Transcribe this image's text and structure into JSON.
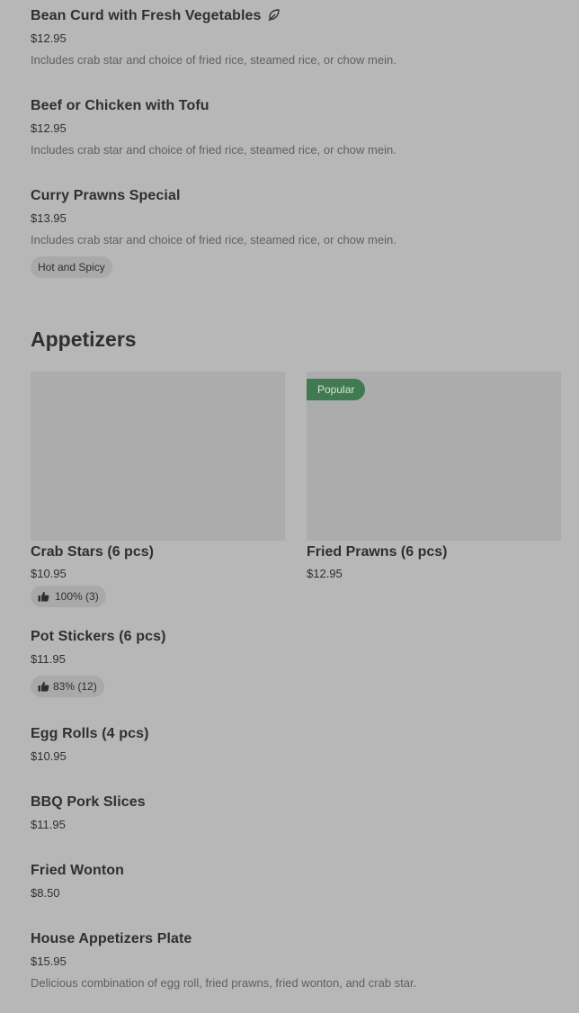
{
  "top_items": [
    {
      "name": "Bean Curd with Fresh Vegetables",
      "price": "$12.95",
      "description": "Includes crab star and choice of fried rice, steamed rice, or chow mein.",
      "icon": "leaf-icon"
    },
    {
      "name": "Beef or Chicken with Tofu",
      "price": "$12.95",
      "description": "Includes crab star and choice of fried rice, steamed rice, or chow mein."
    },
    {
      "name": "Curry Prawns Special",
      "price": "$13.95",
      "description": "Includes crab star and choice of fried rice, steamed rice, or chow mein.",
      "tag": "Hot and Spicy"
    }
  ],
  "section": {
    "title": "Appetizers"
  },
  "featured": [
    {
      "name": "Crab Stars (6 pcs)",
      "price": "$10.95",
      "rating": "100% (3)"
    },
    {
      "name": "Fried Prawns (6 pcs)",
      "price": "$12.95",
      "badge": "Popular"
    }
  ],
  "list_items": [
    {
      "name": "Pot Stickers (6 pcs)",
      "price": "$11.95",
      "rating": "83% (12)"
    },
    {
      "name": "Egg Rolls (4 pcs)",
      "price": "$10.95"
    },
    {
      "name": "BBQ Pork Slices",
      "price": "$11.95"
    },
    {
      "name": "Fried Wonton",
      "price": "$8.50"
    },
    {
      "name": "House Appetizers Plate",
      "price": "$15.95",
      "description": "Delicious combination of egg roll, fried prawns, fried wonton, and crab star."
    }
  ],
  "colors": {
    "background": "#b7b7b7",
    "popular_badge": "#3f7a50",
    "image_placeholder": "#acacac",
    "pill": "#a9a9a9"
  }
}
